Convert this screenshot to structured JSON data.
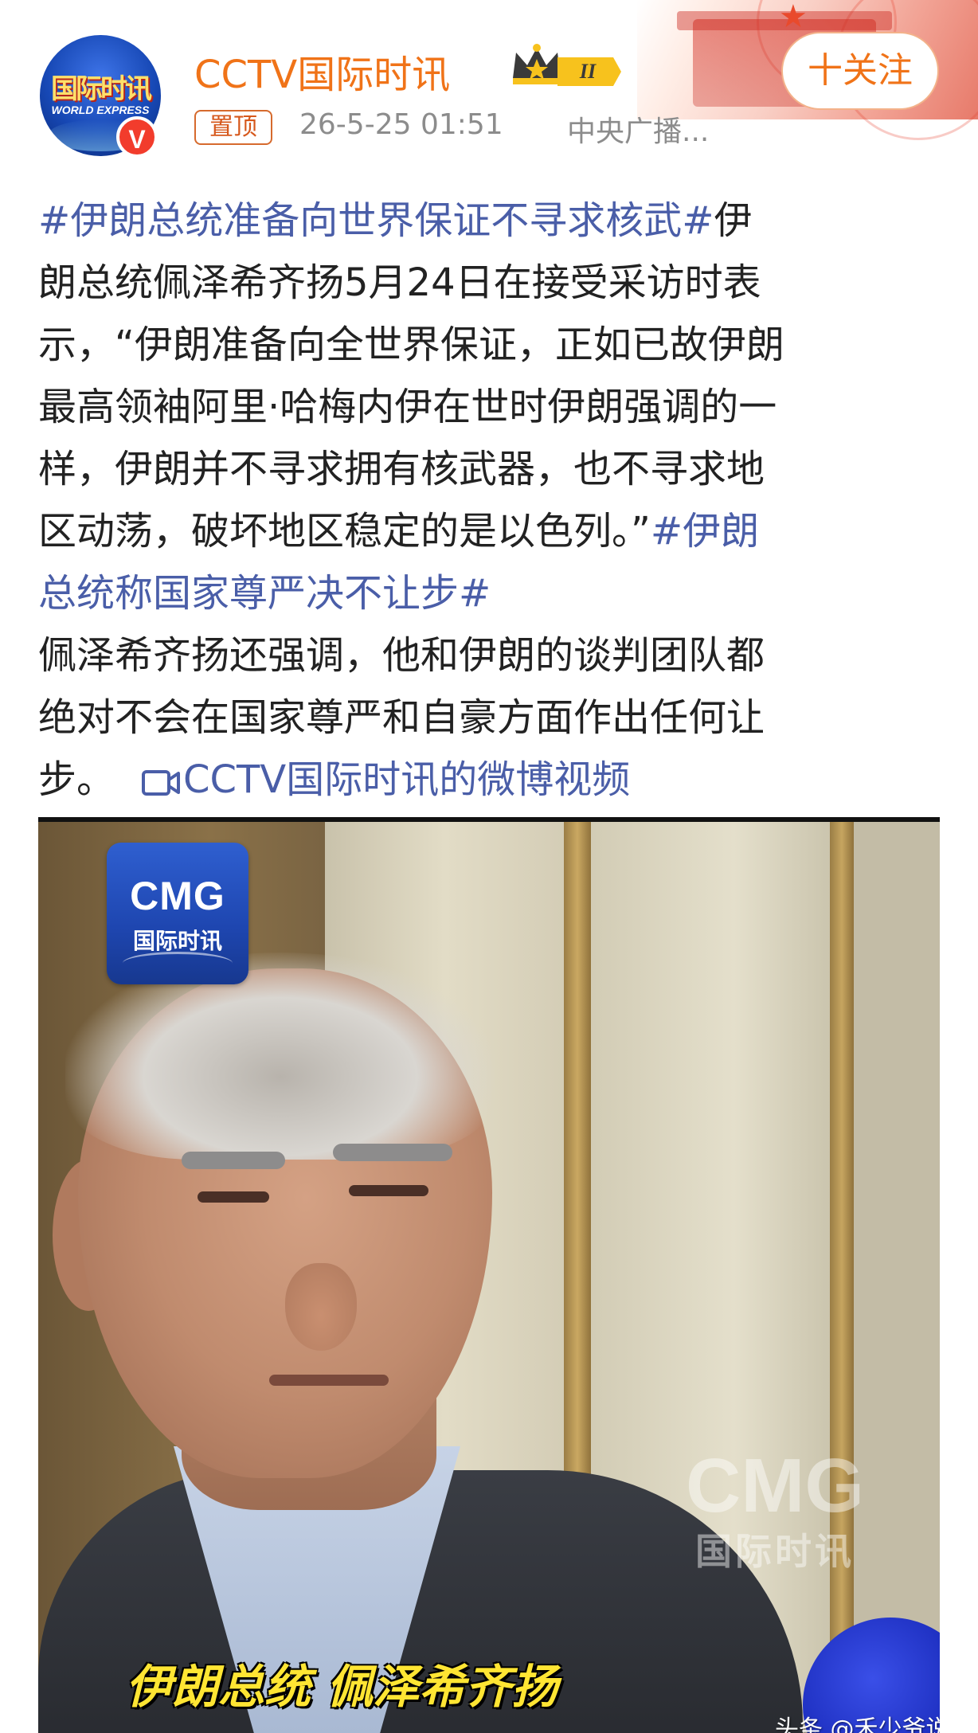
{
  "header": {
    "username": "CCTV国际时讯",
    "pin_label": "置顶",
    "timestamp": "26-5-25 01:51",
    "source": "中央广播...",
    "follow_label": "十关注",
    "verified_mark": "V",
    "avatar": {
      "title": "国际时讯",
      "subtitle": "WORLD EXPRESS"
    },
    "level_badge": "II"
  },
  "post": {
    "lines": [
      {
        "tag": "#伊朗总统准备向世界保证不寻求核武#",
        "text": "伊"
      },
      {
        "text": "朗总统佩泽希齐扬5月24日在接受采访时表"
      },
      {
        "text": "示，“伊朗准备向全世界保证，正如已故伊朗"
      },
      {
        "text": "最高领袖阿里·哈梅内伊在世时伊朗强调的一"
      },
      {
        "text": "样，伊朗并不寻求拥有核武器，也不寻求地"
      },
      {
        "text": "区动荡，破坏地区稳定的是以色列。”",
        "tag": "#伊朗"
      },
      {
        "tag": "总统称国家尊严决不让步#"
      },
      {
        "text": "佩泽希齐扬还强调，他和伊朗的谈判团队都"
      },
      {
        "text": "绝对不会在国家尊严和自豪方面作出任何让"
      },
      {
        "text": "步。",
        "link": "CCTV国际时讯的微博视频"
      }
    ]
  },
  "video": {
    "logo": {
      "big": "CMG",
      "small": "国际时讯"
    },
    "watermark": {
      "big": "CMG",
      "small": "国际时讯"
    },
    "caption": "伊朗总统 佩泽希齐扬",
    "source_watermark": "头条 @禾少爷说"
  },
  "colors": {
    "accent": "#f07318",
    "link": "#4a5ea8",
    "text": "#222222",
    "meta": "#8c8c8c"
  }
}
